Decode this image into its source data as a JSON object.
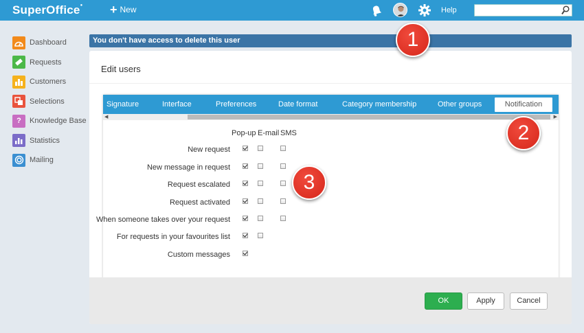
{
  "app": {
    "logo": "SuperOffice",
    "new_label": "New",
    "help_label": "Help",
    "search_placeholder": ""
  },
  "sidebar": {
    "items": [
      {
        "label": "Dashboard",
        "icon": "dashboard-icon",
        "color": "#f28a1b"
      },
      {
        "label": "Requests",
        "icon": "ticket-icon",
        "color": "#4cb848"
      },
      {
        "label": "Customers",
        "icon": "customers-icon",
        "color": "#f5b21d"
      },
      {
        "label": "Selections",
        "icon": "selections-icon",
        "color": "#e9533d"
      },
      {
        "label": "Knowledge Base",
        "icon": "question-icon",
        "color": "#c86ec2"
      },
      {
        "label": "Statistics",
        "icon": "statistics-icon",
        "color": "#7b6cc8"
      },
      {
        "label": "Mailing",
        "icon": "mailing-icon",
        "color": "#3b8fd1"
      }
    ]
  },
  "alert": {
    "text": "You don't have access to delete this user"
  },
  "panel": {
    "title": "Edit users",
    "tabs": [
      "Signature",
      "Interface",
      "Preferences",
      "Date format",
      "Category membership",
      "Other groups",
      "Notification"
    ],
    "active_tab": "Notification",
    "columns": [
      "Pop-up",
      "E-mail",
      "SMS"
    ],
    "rows": [
      {
        "label": "New request",
        "popup": true,
        "email": false,
        "sms": false
      },
      {
        "label": "New message in request",
        "popup": true,
        "email": false,
        "sms": false
      },
      {
        "label": "Request escalated",
        "popup": true,
        "email": false,
        "sms": false
      },
      {
        "label": "Request activated",
        "popup": true,
        "email": false,
        "sms": false
      },
      {
        "label": "When someone takes over your request",
        "popup": true,
        "email": false,
        "sms": false
      },
      {
        "label": "For requests in your favourites list",
        "popup": true,
        "email": false,
        "sms": null
      },
      {
        "label": "Custom messages",
        "popup": true,
        "email": null,
        "sms": null
      }
    ]
  },
  "buttons": {
    "ok": "OK",
    "apply": "Apply",
    "cancel": "Cancel"
  },
  "callouts": [
    "1",
    "2",
    "3"
  ],
  "colors": {
    "header": "#2e9ad3",
    "alert": "#3b74a6",
    "ok": "#2dae4f",
    "callout": "#e0352a"
  }
}
